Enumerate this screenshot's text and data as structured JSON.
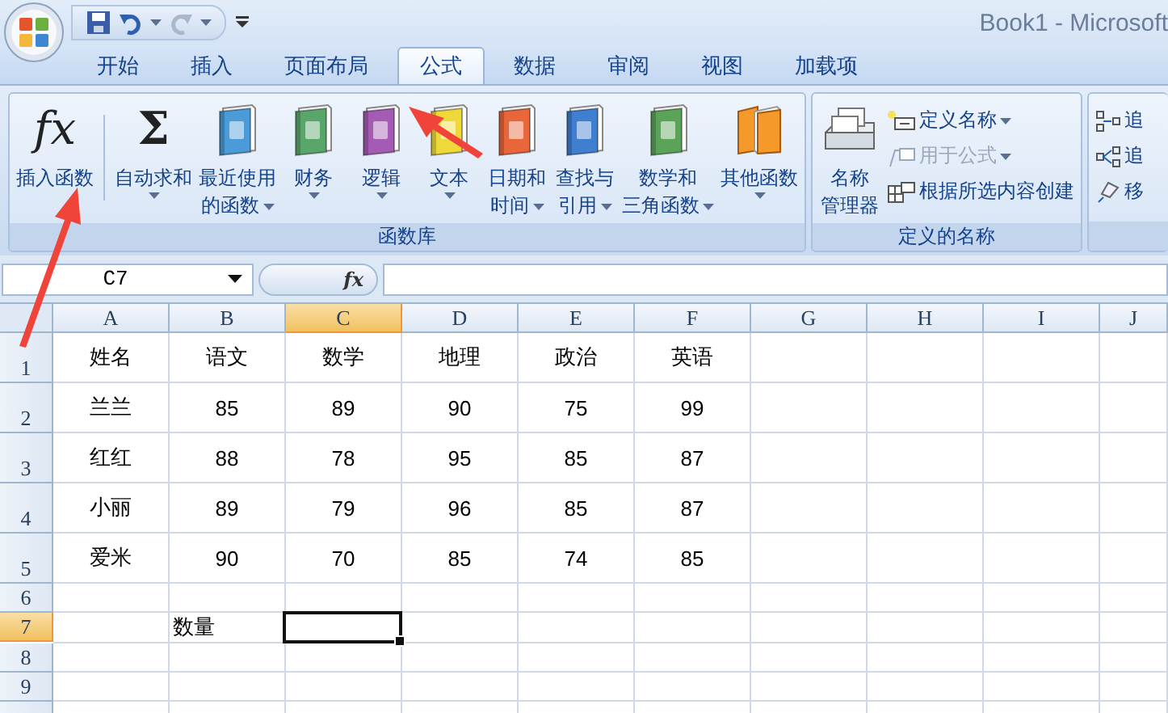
{
  "window": {
    "title": "Book1 - Microsoft"
  },
  "tabs": [
    {
      "label": "开始",
      "selected": false
    },
    {
      "label": "插入",
      "selected": false
    },
    {
      "label": "页面布局",
      "selected": false
    },
    {
      "label": "公式",
      "selected": true
    },
    {
      "label": "数据",
      "selected": false
    },
    {
      "label": "审阅",
      "selected": false
    },
    {
      "label": "视图",
      "selected": false
    },
    {
      "label": "加载项",
      "selected": false
    }
  ],
  "ribbon": {
    "groups": [
      {
        "label": "函数库",
        "buttons": [
          {
            "kind": "glyph",
            "glyph": "fx",
            "lines": [
              "插入函数"
            ],
            "dropdown": false
          },
          {
            "kind": "glyph",
            "glyph": "Σ",
            "lines": [
              "自动求和"
            ],
            "dropdown": true
          },
          {
            "kind": "book",
            "color": "#4a9bd8",
            "lines": [
              "最近使用",
              "的函数"
            ],
            "dropdown": true
          },
          {
            "kind": "book",
            "color": "#5aa66a",
            "lines": [
              "财务"
            ],
            "dropdown": true
          },
          {
            "kind": "book",
            "color": "#a45bb3",
            "lines": [
              "逻辑"
            ],
            "dropdown": true
          },
          {
            "kind": "book",
            "color": "#efd93a",
            "lines": [
              "文本"
            ],
            "dropdown": true
          },
          {
            "kind": "book",
            "color": "#e8663a",
            "lines": [
              "日期和",
              "时间"
            ],
            "dropdown": true
          },
          {
            "kind": "book",
            "color": "#3f7fcf",
            "lines": [
              "查找与",
              "引用"
            ],
            "dropdown": true
          },
          {
            "kind": "book",
            "color": "#5ca35a",
            "lines": [
              "数学和",
              "三角函数"
            ],
            "dropdown": true
          },
          {
            "kind": "books",
            "color": "#f59a2a",
            "lines": [
              "其他函数"
            ],
            "dropdown": true
          }
        ]
      },
      {
        "label": "定义的名称",
        "buttons": [
          {
            "kind": "cabinet",
            "lines": [
              "名称",
              "管理器"
            ],
            "dropdown": false
          }
        ],
        "small": [
          {
            "kind": "define",
            "label": "定义名称",
            "dropdown": true,
            "disabled": false
          },
          {
            "kind": "use",
            "label": "用于公式",
            "dropdown": true,
            "disabled": true
          },
          {
            "kind": "create",
            "label": "根据所选内容创建",
            "dropdown": false,
            "disabled": false
          }
        ]
      },
      {
        "small": [
          {
            "kind": "precedents",
            "label": "追",
            "dropdown": false,
            "disabled": false
          },
          {
            "kind": "dependents",
            "label": "追",
            "dropdown": false,
            "disabled": false
          },
          {
            "kind": "remove",
            "label": "移",
            "dropdown": false,
            "disabled": false
          }
        ]
      }
    ]
  },
  "formula_bar": {
    "name_box": "C7",
    "fx": "fx"
  },
  "sheet": {
    "columns": [
      {
        "label": "A",
        "selected": false
      },
      {
        "label": "B",
        "selected": false
      },
      {
        "label": "C",
        "selected": true
      },
      {
        "label": "D",
        "selected": false
      },
      {
        "label": "E",
        "selected": false
      },
      {
        "label": "F",
        "selected": false
      },
      {
        "label": "G",
        "selected": false
      },
      {
        "label": "H",
        "selected": false
      },
      {
        "label": "I",
        "selected": false
      },
      {
        "label": "J",
        "selected": false
      }
    ],
    "rows": [
      {
        "label": "1",
        "kind": "tall",
        "selected": false,
        "cells": [
          "姓名",
          "语文",
          "数学",
          "地理",
          "政治",
          "英语"
        ]
      },
      {
        "label": "2",
        "kind": "tall",
        "selected": false,
        "cells": [
          "兰兰",
          "85",
          "89",
          "90",
          "75",
          "99"
        ]
      },
      {
        "label": "3",
        "kind": "tall",
        "selected": false,
        "cells": [
          "红红",
          "88",
          "78",
          "95",
          "85",
          "87"
        ]
      },
      {
        "label": "4",
        "kind": "tall",
        "selected": false,
        "cells": [
          "小丽",
          "89",
          "79",
          "96",
          "85",
          "87"
        ]
      },
      {
        "label": "5",
        "kind": "tall",
        "selected": false,
        "cells": [
          "爱米",
          "90",
          "70",
          "85",
          "74",
          "85"
        ]
      },
      {
        "label": "6",
        "kind": "normal",
        "selected": false,
        "cells": []
      },
      {
        "label": "7",
        "kind": "normal",
        "selected": true,
        "cells": [
          null,
          {
            "text": "数量",
            "centered": false
          }
        ]
      },
      {
        "label": "8",
        "kind": "normal",
        "selected": false,
        "cells": []
      },
      {
        "label": "9",
        "kind": "normal",
        "selected": false,
        "cells": []
      }
    ]
  }
}
